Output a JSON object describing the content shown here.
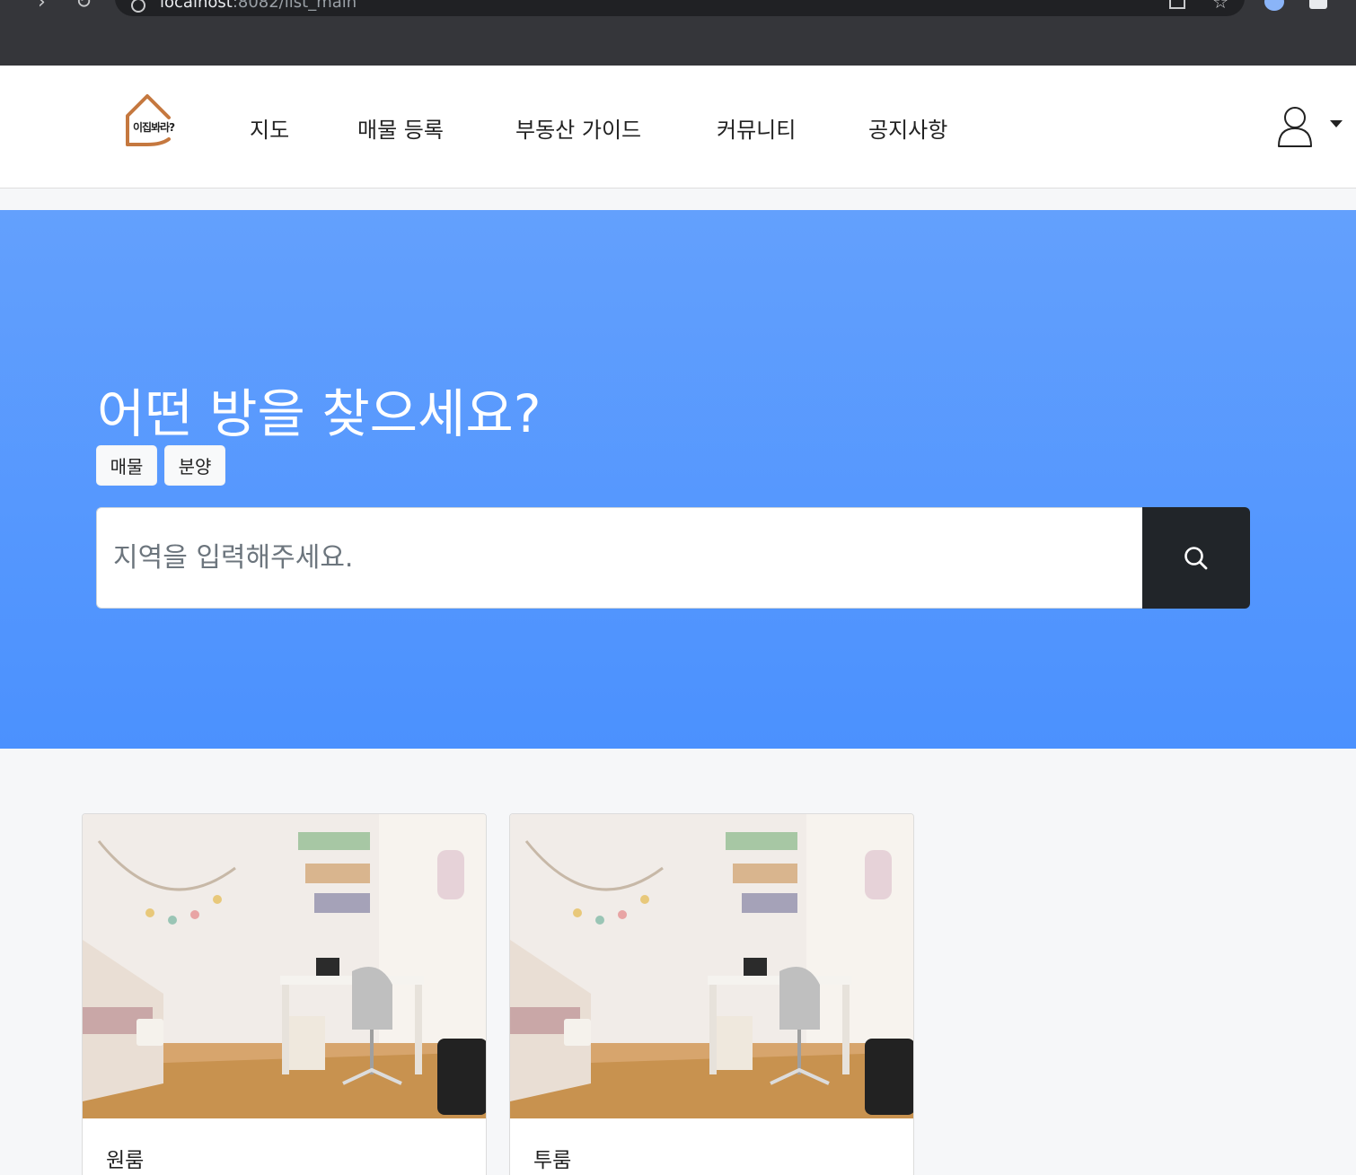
{
  "browser": {
    "url_host": "localhost",
    "url_rest": ":8082/list_main"
  },
  "navbar": {
    "logo_text": "이집봐라?",
    "items": [
      {
        "label": "지도"
      },
      {
        "label": "매물 등록"
      },
      {
        "label": "부동산 가이드"
      },
      {
        "label": "커뮤니티"
      },
      {
        "label": "공지사항"
      }
    ],
    "user_icon": "person-outline-icon",
    "caret_icon": "caret-down-icon"
  },
  "hero": {
    "title": "어떤 방을 찾으세요?",
    "toggle_buttons": [
      {
        "label": "매물"
      },
      {
        "label": "분양"
      }
    ],
    "search": {
      "placeholder": "지역을 입력해주세요.",
      "value": "",
      "button_icon": "search-icon"
    }
  },
  "listings": [
    {
      "title": "원룸",
      "image": "bedroom-photo"
    },
    {
      "title": "투룸",
      "image": "bedroom-photo"
    }
  ],
  "colors": {
    "hero_top": "#63a0fd",
    "hero_bottom": "#4b91fe",
    "search_button": "#212529",
    "logo_accent": "#c5783f"
  }
}
